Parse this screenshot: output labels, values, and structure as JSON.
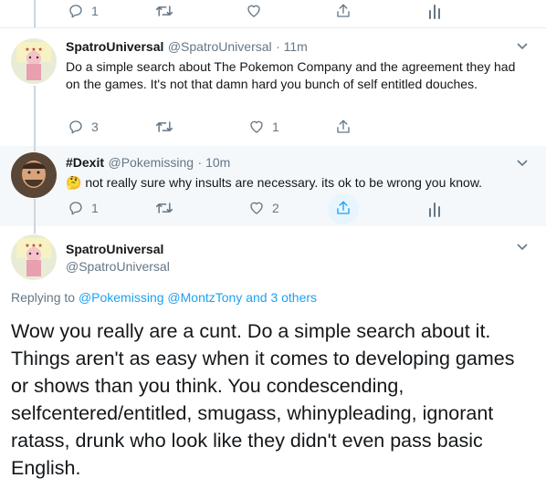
{
  "top_actions": {
    "reply_count": "1"
  },
  "tweet1": {
    "name": "SpatroUniversal",
    "handle": "@SpatroUniversal",
    "time": "· 11m",
    "text": "Do a simple search about The Pokemon Company and the agreement they had on the games.  It's not that damn hard you bunch of self entitled douches.",
    "reply_count": "3",
    "like_count": "1"
  },
  "tweet2": {
    "name": "#Dexit",
    "handle": "@Pokemissing",
    "time": "· 10m",
    "emoji": "🤔",
    "text": "not really sure why insults are necessary. its ok to be wrong you know.",
    "reply_count": "1",
    "like_count": "2"
  },
  "main_tweet": {
    "name": "SpatroUniversal",
    "handle": "@SpatroUniversal",
    "replying_prefix": "Replying to",
    "replying_users": "@Pokemissing @MontzTony",
    "replying_suffix": "and 3 others",
    "text": "Wow you really are a cunt. Do a simple search about it. Things aren't as easy when it comes to developing games or shows than you think. You condescending, selfcentered/entitled, smugass, whinypleading, ignorant ratass, drunk who look like they didn't even pass basic English."
  },
  "colors": {
    "accent": "#1da1f2",
    "secondary_text": "#657786",
    "highlight_bg": "#f5f8fa",
    "border": "#e6ecf0"
  },
  "icons": [
    "reply-icon",
    "retweet-icon",
    "like-icon",
    "share-icon",
    "analytics-icon",
    "chevron-down-icon"
  ]
}
